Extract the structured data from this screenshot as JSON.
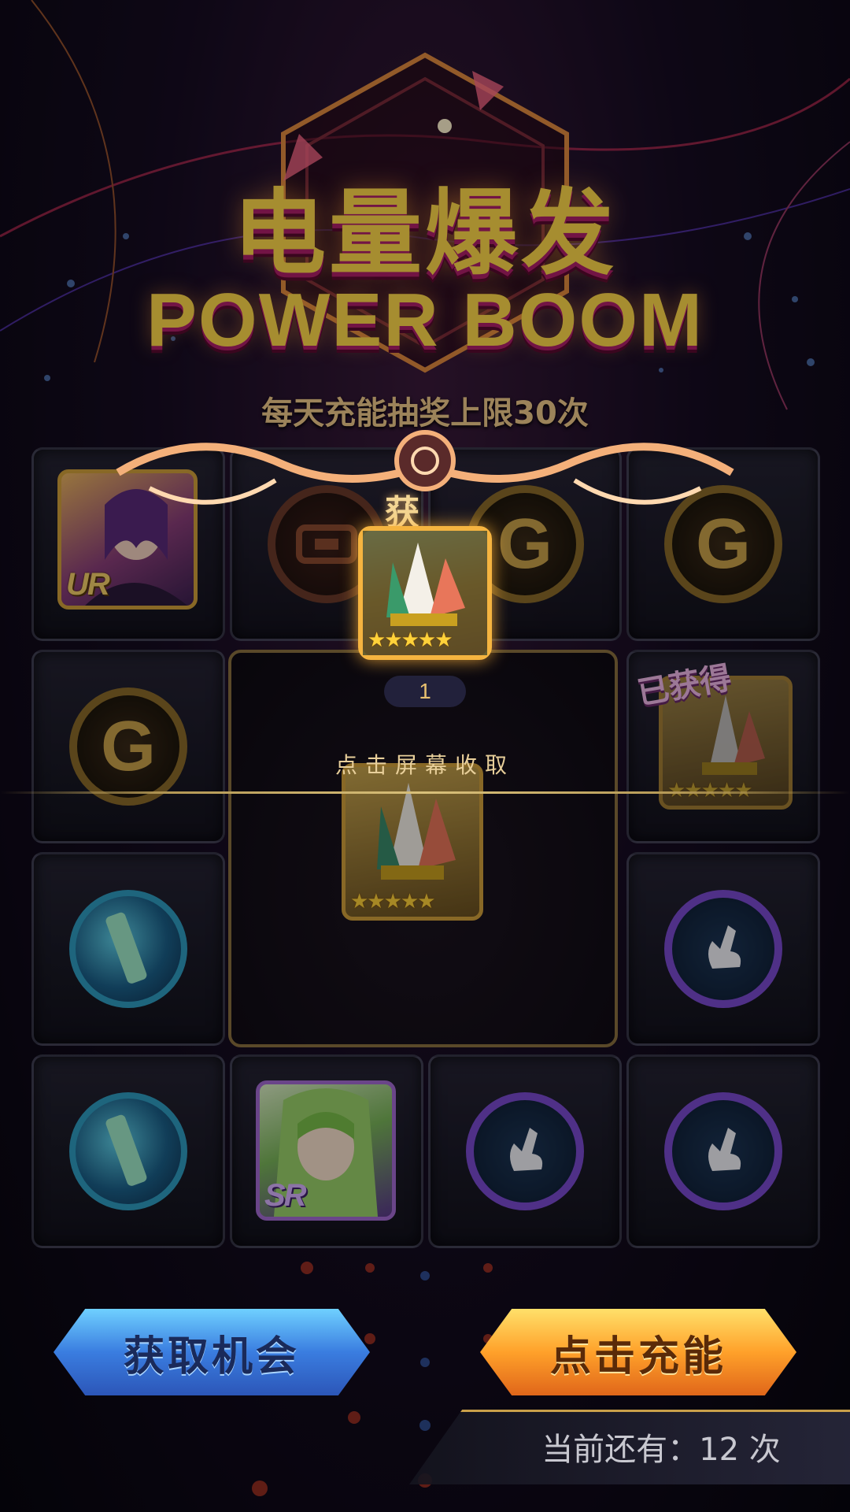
{
  "title": {
    "cn": "电量爆发",
    "en": "POWER BOOM",
    "subtitle": "每天充能抽奖上限30次"
  },
  "grid": {
    "cells": [
      {
        "type": "ur-card",
        "rarity": "UR"
      },
      {
        "type": "coin-special"
      },
      {
        "type": "coin",
        "glyph": "G"
      },
      {
        "type": "coin",
        "glyph": "G"
      },
      {
        "type": "coin",
        "glyph": "G"
      },
      {
        "type": "reward-card",
        "status": "已获得",
        "stars": "★★★★★"
      },
      {
        "type": "blue-orb"
      },
      {
        "type": "purple-hand"
      },
      {
        "type": "blue-orb"
      },
      {
        "type": "sr-card",
        "rarity": "SR"
      },
      {
        "type": "purple-hand"
      },
      {
        "type": "purple-hand"
      }
    ],
    "center_card_stars": "★★★★★"
  },
  "reward_popup": {
    "label": "获 得",
    "stars": "★★★★★",
    "count": "1",
    "tap_hint": "点击屏幕收取"
  },
  "buttons": {
    "get_chance": "获取机会",
    "charge": "点击充能"
  },
  "remaining": {
    "text": "当前还有：12 次"
  },
  "colors": {
    "gold": "#ffd94a",
    "magenta": "#b0206a",
    "blue_button": "#3a7de0",
    "orange_button": "#ffa12a"
  }
}
